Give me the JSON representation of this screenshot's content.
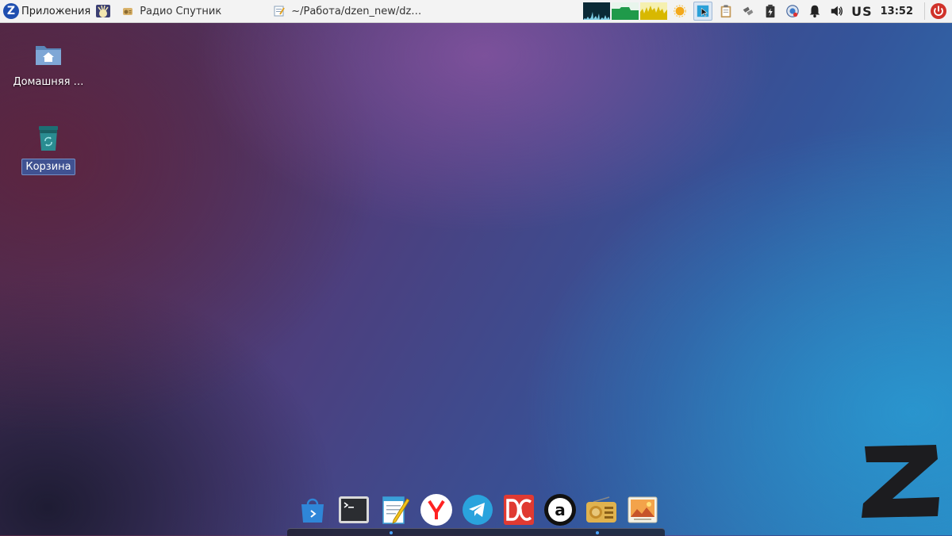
{
  "topbar": {
    "apps_label": "Приложения",
    "task1_label": "Радио Спутник",
    "task2_label": "~/Работа/dzen_new/dz…",
    "lang": "US",
    "clock": "13:52"
  },
  "desktop": {
    "home_label": "Домашняя …",
    "trash_label": "Корзина"
  },
  "dock": {
    "items": [
      "software-store-icon",
      "terminal-icon",
      "text-editor-icon",
      "yandex-browser-icon",
      "telegram-icon",
      "double-commander-icon",
      "anydesk-icon",
      "radio-icon",
      "image-viewer-icon"
    ]
  },
  "colors": {
    "panel_bg": "#f3f3f3",
    "accent_blue": "#1f4fb0",
    "power_red": "#d0322a"
  }
}
